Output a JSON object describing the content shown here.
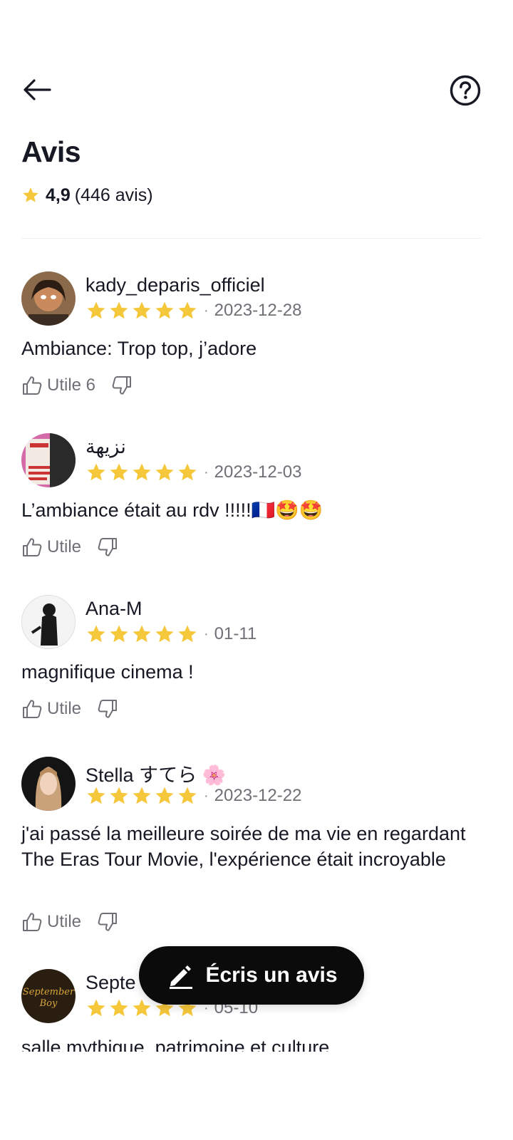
{
  "header": {
    "title": "Avis"
  },
  "summary": {
    "score": "4,9",
    "count": "(446 avis)"
  },
  "reviews": [
    {
      "username": "kady_deparis_officiel",
      "date": "2023-12-28",
      "text": "Ambiance: Trop top, j’adore",
      "useful": "Utile 6",
      "rating": 5
    },
    {
      "username": "نزيهة",
      "date": "2023-12-03",
      "text": "L’ambiance était au rdv !!!!!🇫🇷🤩🤩",
      "useful": "Utile",
      "rating": 5
    },
    {
      "username": "Ana-M",
      "date": "01-11",
      "text": "magnifique cinema !",
      "useful": "Utile",
      "rating": 5
    },
    {
      "username": "Stella すてら 🌸",
      "date": "2023-12-22",
      "text": "j'ai passé la meilleure soirée de ma vie en regardant The Eras Tour Movie, l'expérience était incroyable",
      "useful": "Utile",
      "rating": 5
    },
    {
      "username": "Septe",
      "date": "05-10",
      "text": "salle mythique, patrimoine et culture",
      "rating": 5
    }
  ],
  "fab": {
    "label": "Écris un avis"
  },
  "colors": {
    "star": "#f5c73a",
    "text": "#161823",
    "muted": "#6f7076",
    "fab_bg": "#0b0b0b"
  },
  "icons": [
    "back-arrow-icon",
    "help-icon",
    "star-icon",
    "thumb-up-icon",
    "thumb-down-icon",
    "pencil-icon"
  ]
}
